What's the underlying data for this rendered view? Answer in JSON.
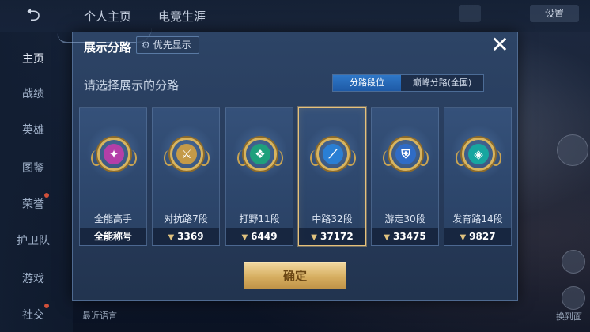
{
  "background": {
    "top_tabs": [
      "个人主页",
      "电竞生涯"
    ],
    "settings_label": "设置",
    "sidebar": [
      {
        "label": "主页",
        "active": true,
        "dot": false
      },
      {
        "label": "战绩",
        "active": false,
        "dot": false
      },
      {
        "label": "英雄",
        "active": false,
        "dot": false
      },
      {
        "label": "图鉴",
        "active": false,
        "dot": false
      },
      {
        "label": "荣誉",
        "active": false,
        "dot": true
      },
      {
        "label": "护卫队",
        "active": false,
        "dot": false
      },
      {
        "label": "游戏",
        "active": false,
        "dot": false
      },
      {
        "label": "社交",
        "active": false,
        "dot": true
      }
    ],
    "bottom_text": "最近语言",
    "right_bottom_label": "换到面"
  },
  "modal": {
    "title": "展示分路",
    "priority_chip": "优先显示",
    "close_icon": "close-icon",
    "subtitle": "请选择展示的分路",
    "toggle": {
      "options": [
        "分路段位",
        "巅峰分路(全国)"
      ],
      "selected": 0
    },
    "cards": [
      {
        "name": "全能高手",
        "footer": "全能称号",
        "has_points": false,
        "badge_color": "#b43fa8",
        "glyph": "✦",
        "selected": false
      },
      {
        "name": "对抗路7段",
        "footer": "3369",
        "has_points": true,
        "badge_color": "#c49a48",
        "glyph": "⚔",
        "selected": false
      },
      {
        "name": "打野11段",
        "footer": "6449",
        "has_points": true,
        "badge_color": "#1fa07c",
        "glyph": "❖",
        "selected": false
      },
      {
        "name": "中路32段",
        "footer": "37172",
        "has_points": true,
        "badge_color": "#2a7fd4",
        "glyph": "⟋",
        "selected": true
      },
      {
        "name": "游走30段",
        "footer": "33475",
        "has_points": true,
        "badge_color": "#2f6cc6",
        "glyph": "⛨",
        "selected": false
      },
      {
        "name": "发育路14段",
        "footer": "9827",
        "has_points": true,
        "badge_color": "#17a6a0",
        "glyph": "◈",
        "selected": false
      }
    ],
    "confirm_label": "确定"
  }
}
